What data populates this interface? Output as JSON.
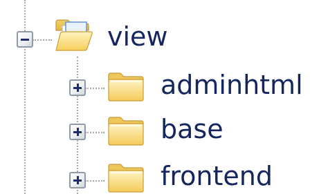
{
  "tree": {
    "root": {
      "label": "view",
      "expanded": true,
      "icon": "folder-open-icon",
      "children": [
        {
          "label": "adminhtml",
          "expanded": false,
          "icon": "folder-icon"
        },
        {
          "label": "base",
          "expanded": false,
          "icon": "folder-icon"
        },
        {
          "label": "frontend",
          "expanded": false,
          "icon": "folder-icon"
        }
      ]
    }
  },
  "colors": {
    "label_text": "#15255e",
    "folder_fill": "#f6d470",
    "connector": "#a9a9a9",
    "toggle_border": "#8e9aa7",
    "toggle_glyph": "#1f2f6e"
  }
}
